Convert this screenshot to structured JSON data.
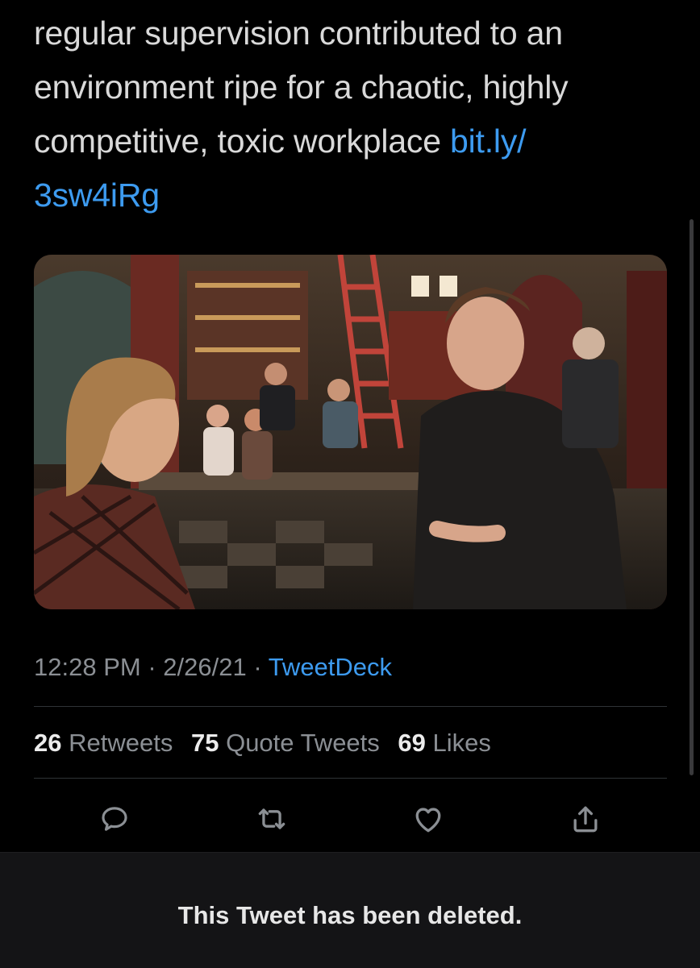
{
  "tweet": {
    "text_lines": [
      "regular supervision contributed to an",
      "environment ripe for a chaotic, highly",
      "competitive, toxic workplace "
    ],
    "link_part1": "bit.ly/",
    "link_part2": "3sw4iRg",
    "time": "12:28 PM",
    "separator": " · ",
    "date": "2/26/21",
    "source": "TweetDeck"
  },
  "stats": {
    "retweets_count": "26",
    "retweets_label": "Retweets",
    "quotes_count": "75",
    "quotes_label": "Quote Tweets",
    "likes_count": "69",
    "likes_label": "Likes"
  },
  "actions": {
    "icons": [
      "reply-icon",
      "retweet-icon",
      "like-icon",
      "share-icon"
    ]
  },
  "footer": {
    "deleted_message": "This Tweet has been deleted."
  },
  "colors": {
    "background": "#000000",
    "text": "#d9d9d9",
    "link": "#3d9bf0",
    "muted": "#8b8f94",
    "footer_bg": "#141416"
  }
}
